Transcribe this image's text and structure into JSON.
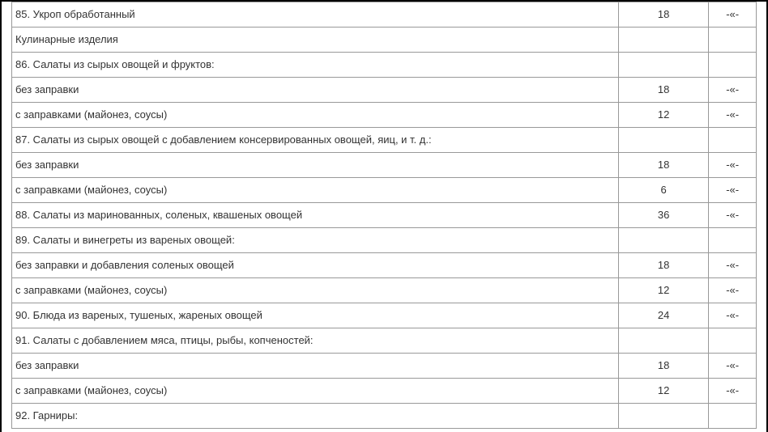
{
  "rows": [
    {
      "name": "85. Укроп обработанный",
      "num": "18",
      "mark": "-«-"
    },
    {
      "name": "Кулинарные изделия",
      "num": "",
      "mark": ""
    },
    {
      "name": "86. Салаты из сырых овощей и фруктов:",
      "num": "",
      "mark": ""
    },
    {
      "name": "без заправки",
      "num": "18",
      "mark": "-«-"
    },
    {
      "name": "с заправками (майонез, соусы)",
      "num": "12",
      "mark": "-«-"
    },
    {
      "name": "87. Салаты из сырых овощей с добавлением консервированных овощей, яиц, и т. д.:",
      "num": "",
      "mark": ""
    },
    {
      "name": "без заправки",
      "num": "18",
      "mark": "-«-"
    },
    {
      "name": "с заправками (майонез, соусы)",
      "num": "6",
      "mark": "-«-"
    },
    {
      "name": "88. Салаты из маринованных, соленых, квашеных овощей",
      "num": "36",
      "mark": "-«-"
    },
    {
      "name": "89. Салаты и винегреты из вареных овощей:",
      "num": "",
      "mark": ""
    },
    {
      "name": "без заправки и добавления соленых овощей",
      "num": "18",
      "mark": "-«-"
    },
    {
      "name": "с заправками (майонез, соусы)",
      "num": "12",
      "mark": "-«-"
    },
    {
      "name": "90. Блюда из вареных, тушеных, жареных овощей",
      "num": "24",
      "mark": "-«-"
    },
    {
      "name": "91. Салаты с добавлением мяса, птицы, рыбы, копченостей:",
      "num": "",
      "mark": ""
    },
    {
      "name": "без заправки",
      "num": "18",
      "mark": "-«-"
    },
    {
      "name": "с заправками (майонез, соусы)",
      "num": "12",
      "mark": "-«-"
    },
    {
      "name": "92. Гарниры:",
      "num": "",
      "mark": ""
    }
  ]
}
